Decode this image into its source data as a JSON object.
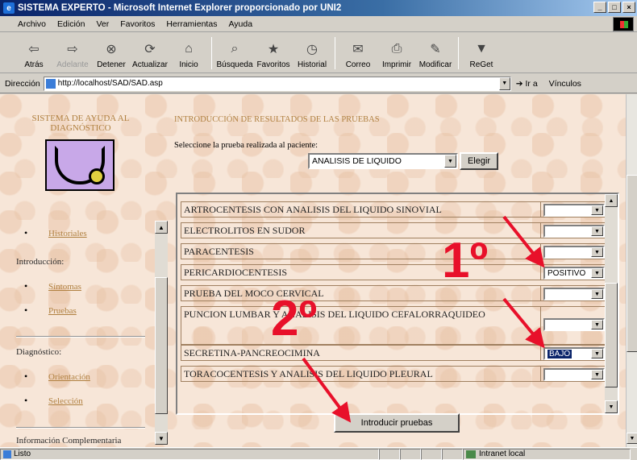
{
  "window": {
    "title": "SISTEMA EXPERTO - Microsoft Internet Explorer proporcionado por UNI2",
    "controls": [
      "_",
      "□",
      "×"
    ]
  },
  "menu": [
    "Archivo",
    "Edición",
    "Ver",
    "Favoritos",
    "Herramientas",
    "Ayuda"
  ],
  "toolbar": [
    {
      "label": "Atrás",
      "icon": "back-arrow-icon"
    },
    {
      "label": "Adelante",
      "icon": "forward-arrow-icon"
    },
    {
      "label": "Detener",
      "icon": "stop-icon"
    },
    {
      "label": "Actualizar",
      "icon": "refresh-icon"
    },
    {
      "label": "Inicio",
      "icon": "home-icon"
    },
    {
      "label": "Búsqueda",
      "icon": "search-icon"
    },
    {
      "label": "Favoritos",
      "icon": "favorites-icon"
    },
    {
      "label": "Historial",
      "icon": "history-icon"
    },
    {
      "label": "Correo",
      "icon": "mail-icon"
    },
    {
      "label": "Imprimir",
      "icon": "print-icon"
    },
    {
      "label": "Modificar",
      "icon": "edit-icon"
    },
    {
      "label": "ReGet",
      "icon": "reget-icon"
    }
  ],
  "address": {
    "label": "Dirección",
    "url": "http://localhost/SAD/SAD.asp",
    "go_label": "Ir a",
    "links_label": "Vínculos"
  },
  "sidebar": {
    "title": "SISTEMA DE AYUDA AL DIAGNÓSTICO",
    "links": {
      "historiales": "Historiales",
      "sintomas": "Síntomas",
      "pruebas": "Pruebas",
      "orientacion": "Orientación",
      "seleccion": "Selección"
    },
    "sections": {
      "introduccion": "Introducción:",
      "diagnostico": "Diagnóstico:",
      "info": "Información Complementaria"
    }
  },
  "main": {
    "title": "INTRODUCCIÓN DE RESULTADOS DE LAS PRUEBAS",
    "prompt": "Seleccione la prueba realizada al paciente:",
    "test_select_value": "ANALISIS DE LIQUIDO",
    "choose_button": "Elegir",
    "tests": [
      {
        "name": "ARTROCENTESIS CON ANALISIS DEL LIQUIDO SINOVIAL",
        "value": ""
      },
      {
        "name": "ELECTROLITOS EN SUDOR",
        "value": ""
      },
      {
        "name": "PARACENTESIS",
        "value": ""
      },
      {
        "name": "PERICARDIOCENTESIS",
        "value": "POSITIVO"
      },
      {
        "name": "PRUEBA DEL MOCO CERVICAL",
        "value": ""
      },
      {
        "name": "PUNCION LUMBAR Y ANALISIS DEL LIQUIDO CEFALORRAQUIDEO",
        "value": ""
      },
      {
        "name": "SECRETINA-PANCREOCIMINA",
        "value": "BAJO"
      },
      {
        "name": "TORACOCENTESIS Y ANALISIS DEL LIQUIDO PLEURAL",
        "value": ""
      }
    ],
    "submit_button": "Introducir pruebas"
  },
  "annotations": {
    "first": "1º",
    "second": "2º",
    "color": "#e8102a"
  },
  "status": {
    "text": "Listo",
    "zone": "Intranet local"
  }
}
